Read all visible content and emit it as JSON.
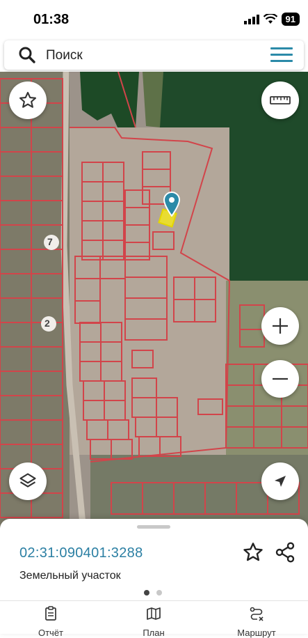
{
  "status": {
    "time": "01:38",
    "battery": "91"
  },
  "search": {
    "placeholder": "Поиск"
  },
  "parcel": {
    "cadastral_number": "02:31:090401:3288",
    "type": "Земельный участок"
  },
  "map_labels": {
    "road_1": "7",
    "road_2": "2"
  },
  "tabs": [
    {
      "label": "Отчёт",
      "icon": "report-icon"
    },
    {
      "label": "План",
      "icon": "map-plan-icon"
    },
    {
      "label": "Маршрут",
      "icon": "route-icon"
    }
  ],
  "carousel": {
    "pages": 2,
    "active": 1
  },
  "colors": {
    "accent": "#2b8aa8",
    "parcel_lines": "#d2444a",
    "selected_parcel": "#f2e51f",
    "forest": "#1f4a2a"
  }
}
